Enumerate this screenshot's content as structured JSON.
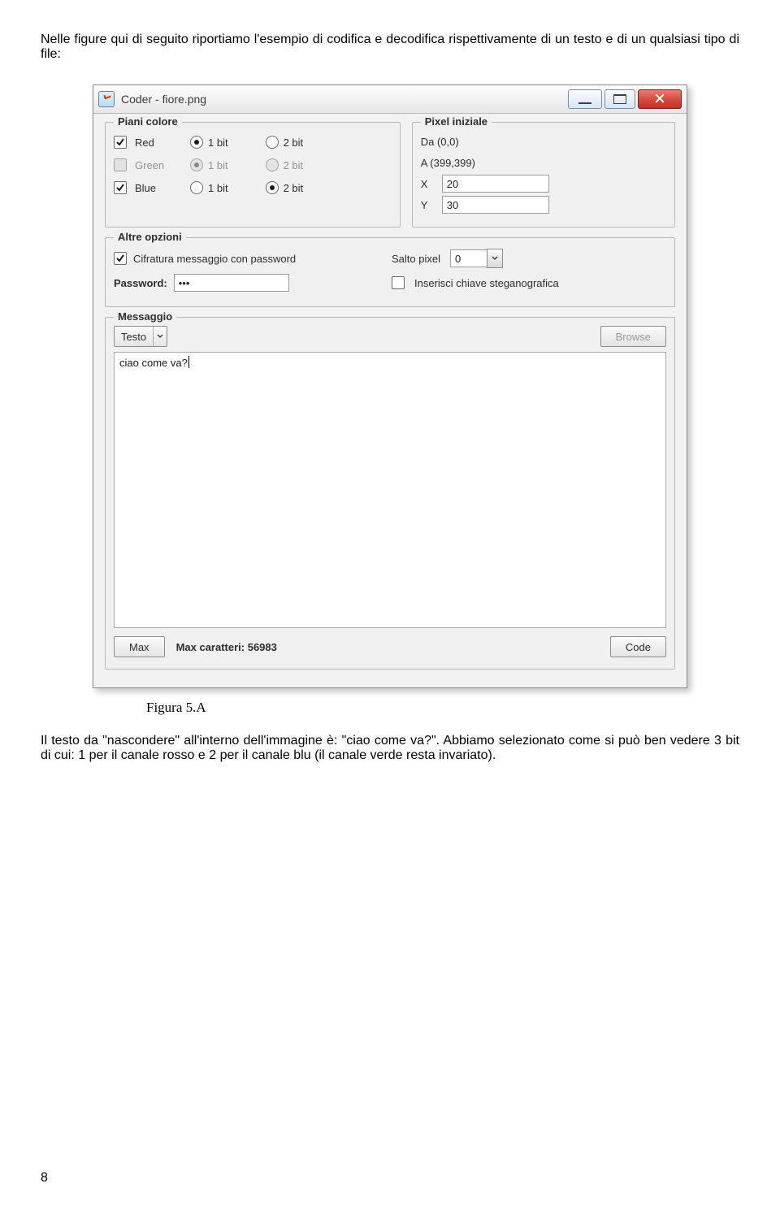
{
  "intro": "Nelle figure qui di seguito riportiamo l'esempio di codifica e decodifica rispettivamente di un testo  e di un qualsiasi tipo di file:",
  "window": {
    "title": "Coder - fiore.png",
    "piani": {
      "legend": "Piani colore",
      "rows": [
        {
          "enabled": true,
          "checked": true,
          "name": "Red",
          "bit1": true,
          "bit2": false
        },
        {
          "enabled": false,
          "checked": false,
          "name": "Green",
          "bit1": true,
          "bit2": false
        },
        {
          "enabled": true,
          "checked": true,
          "name": "Blue",
          "bit1": false,
          "bit2": true
        }
      ],
      "bit1_label": "1 bit",
      "bit2_label": "2 bit"
    },
    "pixel": {
      "legend": "Pixel iniziale",
      "da": "Da (0,0)",
      "a": "A (399,399)",
      "x_label": "X",
      "x_value": "20",
      "y_label": "Y",
      "y_value": "30"
    },
    "altre": {
      "legend": "Altre opzioni",
      "cifratura_label": "Cifratura messaggio con password",
      "password_label": "Password:",
      "password_value": "•••",
      "salto_label": "Salto pixel",
      "salto_value": "0",
      "chiave_label": "Inserisci chiave steganografica"
    },
    "msg": {
      "legend": "Messaggio",
      "combo": "Testo",
      "browse": "Browse",
      "text": "ciao come va?"
    },
    "bottom": {
      "max_btn": "Max",
      "max_chars": "Max caratteri: 56983",
      "code_btn": "Code"
    }
  },
  "caption": "Figura 5.A",
  "para": "Il testo da \"nascondere\" all'interno dell'immagine è: \"ciao come va?\". Abbiamo selezionato come si può ben vedere 3 bit di cui: 1 per il canale rosso e 2 per il canale blu (il canale verde resta invariato).",
  "pagenum": "8"
}
